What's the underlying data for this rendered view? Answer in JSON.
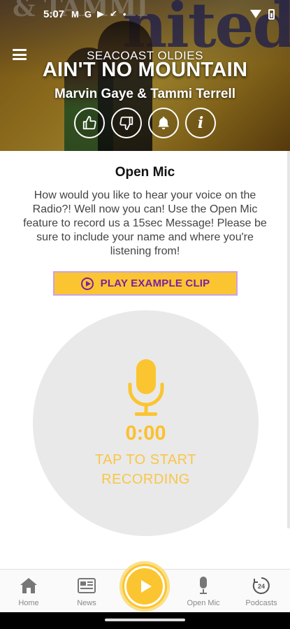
{
  "status_bar": {
    "time": "5:07",
    "icons": [
      "gmail-icon",
      "google-icon",
      "youtube-icon",
      "download-icon",
      "dot-icon"
    ]
  },
  "now_playing": {
    "station": "SEACOAST OLDIES",
    "song": "AIN'T NO MOUNTAIN",
    "artist": "Marvin Gaye & Tammi Terrell",
    "actions": [
      "thumbs-up-icon",
      "thumbs-down-icon",
      "bell-icon",
      "info-icon"
    ],
    "info_glyph": "i"
  },
  "open_mic": {
    "title": "Open Mic",
    "description": "How would you like to hear your voice on the Radio?! Well now you can! Use the Open Mic feature to record us a 15sec Message! Please be sure to include your name and where you're listening from!",
    "play_example_label": "PLAY EXAMPLE CLIP",
    "timer": "0:00",
    "tap_line1": "TAP TO START",
    "tap_line2": "RECORDING"
  },
  "bottom_nav": {
    "items": [
      {
        "label": "Home",
        "icon": "home-icon"
      },
      {
        "label": "News",
        "icon": "news-icon"
      },
      {
        "label": "Open Mic",
        "icon": "microphone-icon"
      },
      {
        "label": "Podcasts",
        "icon": "podcasts-24-icon"
      }
    ]
  },
  "colors": {
    "accent": "#fbc531",
    "accent_text": "#fbc02d",
    "purple": "#7b1fa2"
  }
}
